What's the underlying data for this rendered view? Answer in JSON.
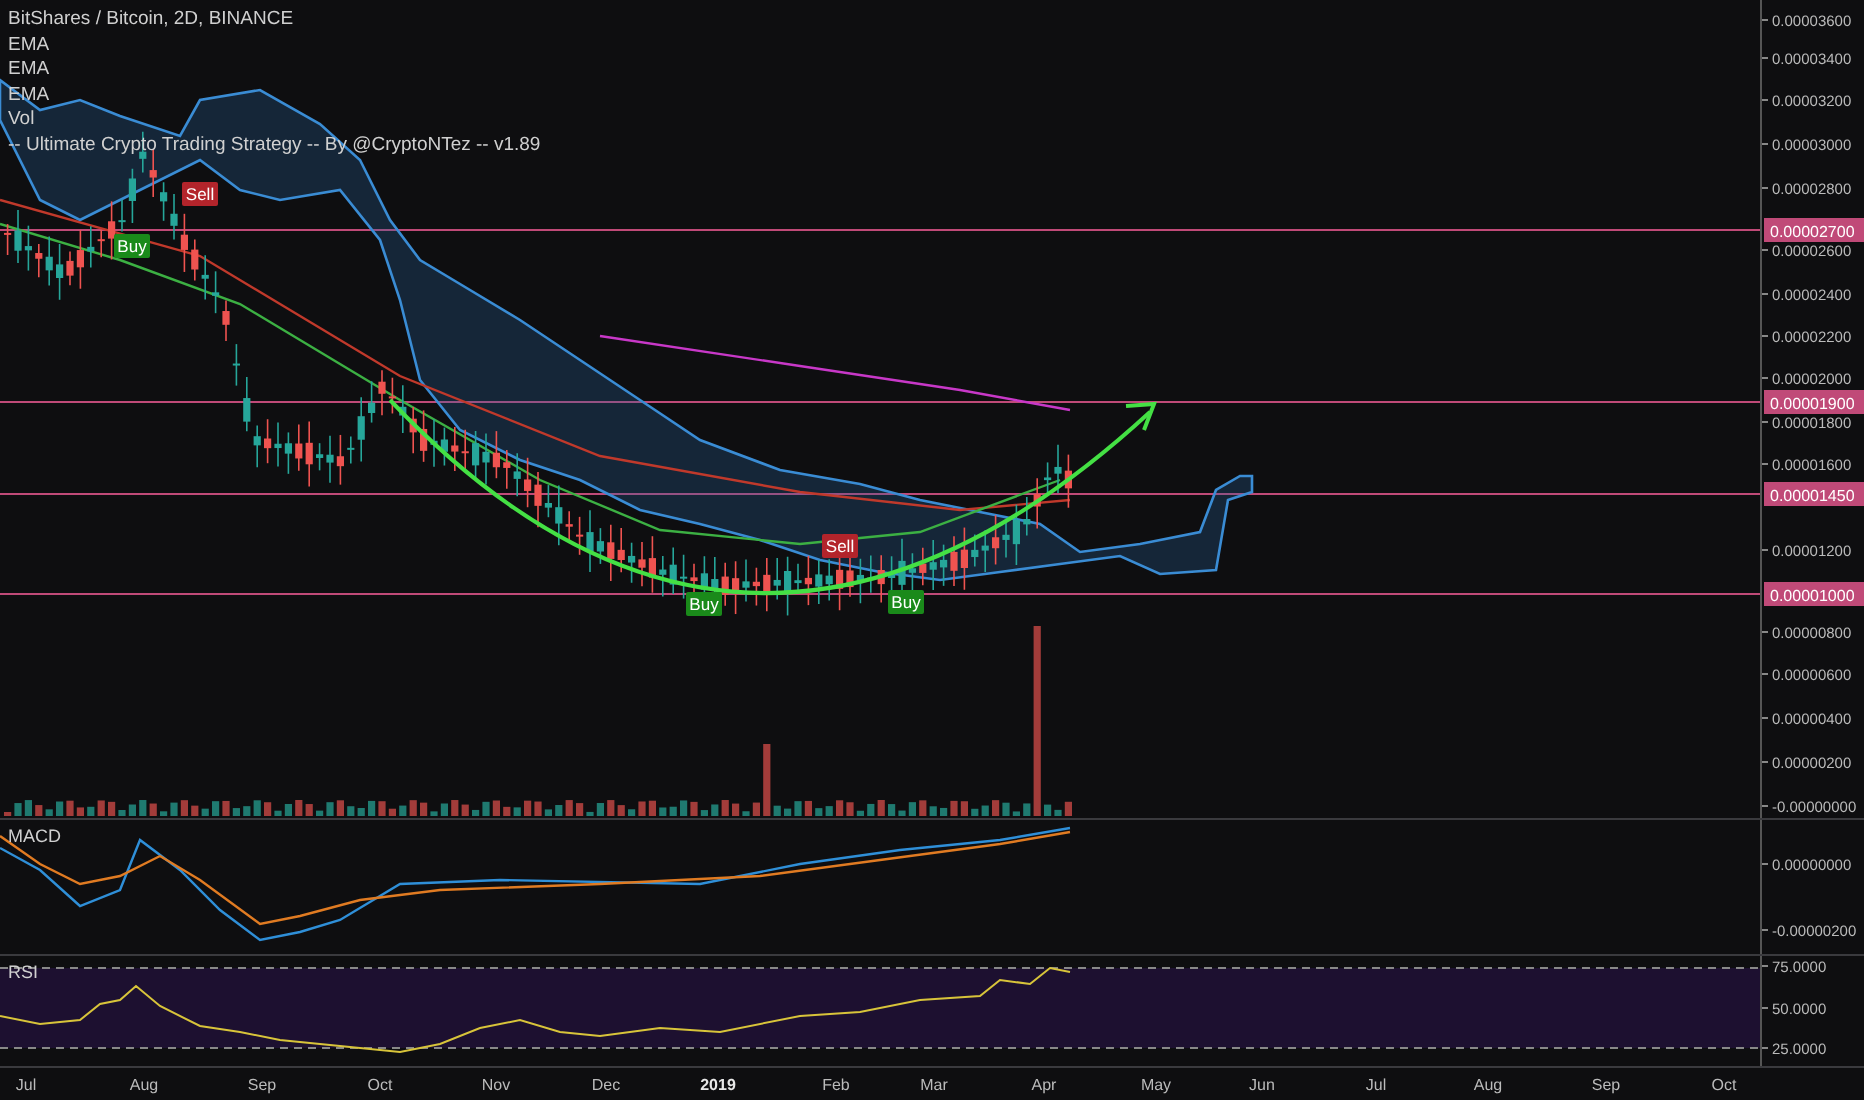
{
  "chart": {
    "title": "BitShares / Bitcoin, 2D, BINANCE",
    "indicators": [
      "EMA",
      "EMA",
      "EMA",
      "Vol",
      "-- Ultimate Crypto Trading Strategy -- By @CryptoNTez -- v1.89"
    ]
  },
  "signals": [
    {
      "label": "Buy",
      "kind": "buy"
    },
    {
      "label": "Sell",
      "kind": "sell"
    },
    {
      "label": "Buy",
      "kind": "buy"
    },
    {
      "label": "Sell",
      "kind": "sell"
    },
    {
      "label": "Buy",
      "kind": "buy"
    }
  ],
  "price_axis": {
    "ticks": [
      {
        "label": "0.00003600",
        "highlighted": false
      },
      {
        "label": "0.00003400",
        "highlighted": false
      },
      {
        "label": "0.00003200",
        "highlighted": false
      },
      {
        "label": "0.00003000",
        "highlighted": false
      },
      {
        "label": "0.00002800",
        "highlighted": false
      },
      {
        "label": "0.00002700",
        "highlighted": true
      },
      {
        "label": "0.00002600",
        "highlighted": false
      },
      {
        "label": "0.00002400",
        "highlighted": false
      },
      {
        "label": "0.00002200",
        "highlighted": false
      },
      {
        "label": "0.00002000",
        "highlighted": false
      },
      {
        "label": "0.00001900",
        "highlighted": true
      },
      {
        "label": "0.00001800",
        "highlighted": false
      },
      {
        "label": "0.00001600",
        "highlighted": false
      },
      {
        "label": "0.00001450",
        "highlighted": true
      },
      {
        "label": "0.00001200",
        "highlighted": false
      },
      {
        "label": "0.00001000",
        "highlighted": true
      },
      {
        "label": "0.00000800",
        "highlighted": false
      },
      {
        "label": "0.00000600",
        "highlighted": false
      },
      {
        "label": "0.00000400",
        "highlighted": false
      },
      {
        "label": "0.00000200",
        "highlighted": false
      },
      {
        "label": "-0.00000000",
        "highlighted": false
      }
    ]
  },
  "macd": {
    "label": "MACD",
    "ticks": [
      "0.00000000",
      "-0.00000200"
    ]
  },
  "rsi": {
    "label": "RSI",
    "ticks": [
      "75.0000",
      "50.0000",
      "25.0000"
    ]
  },
  "time_axis": [
    {
      "label": "Jul",
      "year": false
    },
    {
      "label": "Aug",
      "year": false
    },
    {
      "label": "Sep",
      "year": false
    },
    {
      "label": "Oct",
      "year": false
    },
    {
      "label": "Nov",
      "year": false
    },
    {
      "label": "Dec",
      "year": false
    },
    {
      "label": "2019",
      "year": true
    },
    {
      "label": "Feb",
      "year": false
    },
    {
      "label": "Mar",
      "year": false
    },
    {
      "label": "Apr",
      "year": false
    },
    {
      "label": "May",
      "year": false
    },
    {
      "label": "Jun",
      "year": false
    },
    {
      "label": "Jul",
      "year": false
    },
    {
      "label": "Aug",
      "year": false
    },
    {
      "label": "Sep",
      "year": false
    },
    {
      "label": "Oct",
      "year": false
    }
  ]
}
